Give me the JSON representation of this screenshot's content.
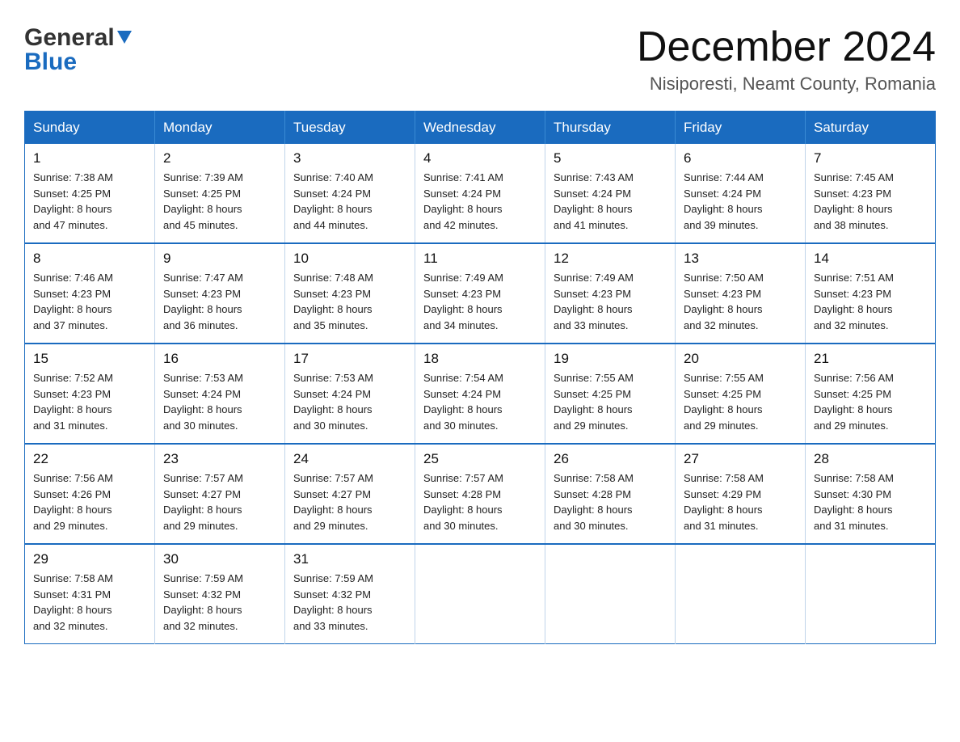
{
  "header": {
    "logo_general": "General",
    "logo_blue": "Blue",
    "title": "December 2024",
    "subtitle": "Nisiporesti, Neamt County, Romania"
  },
  "weekdays": [
    "Sunday",
    "Monday",
    "Tuesday",
    "Wednesday",
    "Thursday",
    "Friday",
    "Saturday"
  ],
  "weeks": [
    [
      {
        "day": 1,
        "sunrise": "7:38 AM",
        "sunset": "4:25 PM",
        "daylight": "8 hours and 47 minutes."
      },
      {
        "day": 2,
        "sunrise": "7:39 AM",
        "sunset": "4:25 PM",
        "daylight": "8 hours and 45 minutes."
      },
      {
        "day": 3,
        "sunrise": "7:40 AM",
        "sunset": "4:24 PM",
        "daylight": "8 hours and 44 minutes."
      },
      {
        "day": 4,
        "sunrise": "7:41 AM",
        "sunset": "4:24 PM",
        "daylight": "8 hours and 42 minutes."
      },
      {
        "day": 5,
        "sunrise": "7:43 AM",
        "sunset": "4:24 PM",
        "daylight": "8 hours and 41 minutes."
      },
      {
        "day": 6,
        "sunrise": "7:44 AM",
        "sunset": "4:24 PM",
        "daylight": "8 hours and 39 minutes."
      },
      {
        "day": 7,
        "sunrise": "7:45 AM",
        "sunset": "4:23 PM",
        "daylight": "8 hours and 38 minutes."
      }
    ],
    [
      {
        "day": 8,
        "sunrise": "7:46 AM",
        "sunset": "4:23 PM",
        "daylight": "8 hours and 37 minutes."
      },
      {
        "day": 9,
        "sunrise": "7:47 AM",
        "sunset": "4:23 PM",
        "daylight": "8 hours and 36 minutes."
      },
      {
        "day": 10,
        "sunrise": "7:48 AM",
        "sunset": "4:23 PM",
        "daylight": "8 hours and 35 minutes."
      },
      {
        "day": 11,
        "sunrise": "7:49 AM",
        "sunset": "4:23 PM",
        "daylight": "8 hours and 34 minutes."
      },
      {
        "day": 12,
        "sunrise": "7:49 AM",
        "sunset": "4:23 PM",
        "daylight": "8 hours and 33 minutes."
      },
      {
        "day": 13,
        "sunrise": "7:50 AM",
        "sunset": "4:23 PM",
        "daylight": "8 hours and 32 minutes."
      },
      {
        "day": 14,
        "sunrise": "7:51 AM",
        "sunset": "4:23 PM",
        "daylight": "8 hours and 32 minutes."
      }
    ],
    [
      {
        "day": 15,
        "sunrise": "7:52 AM",
        "sunset": "4:23 PM",
        "daylight": "8 hours and 31 minutes."
      },
      {
        "day": 16,
        "sunrise": "7:53 AM",
        "sunset": "4:24 PM",
        "daylight": "8 hours and 30 minutes."
      },
      {
        "day": 17,
        "sunrise": "7:53 AM",
        "sunset": "4:24 PM",
        "daylight": "8 hours and 30 minutes."
      },
      {
        "day": 18,
        "sunrise": "7:54 AM",
        "sunset": "4:24 PM",
        "daylight": "8 hours and 30 minutes."
      },
      {
        "day": 19,
        "sunrise": "7:55 AM",
        "sunset": "4:25 PM",
        "daylight": "8 hours and 29 minutes."
      },
      {
        "day": 20,
        "sunrise": "7:55 AM",
        "sunset": "4:25 PM",
        "daylight": "8 hours and 29 minutes."
      },
      {
        "day": 21,
        "sunrise": "7:56 AM",
        "sunset": "4:25 PM",
        "daylight": "8 hours and 29 minutes."
      }
    ],
    [
      {
        "day": 22,
        "sunrise": "7:56 AM",
        "sunset": "4:26 PM",
        "daylight": "8 hours and 29 minutes."
      },
      {
        "day": 23,
        "sunrise": "7:57 AM",
        "sunset": "4:27 PM",
        "daylight": "8 hours and 29 minutes."
      },
      {
        "day": 24,
        "sunrise": "7:57 AM",
        "sunset": "4:27 PM",
        "daylight": "8 hours and 29 minutes."
      },
      {
        "day": 25,
        "sunrise": "7:57 AM",
        "sunset": "4:28 PM",
        "daylight": "8 hours and 30 minutes."
      },
      {
        "day": 26,
        "sunrise": "7:58 AM",
        "sunset": "4:28 PM",
        "daylight": "8 hours and 30 minutes."
      },
      {
        "day": 27,
        "sunrise": "7:58 AM",
        "sunset": "4:29 PM",
        "daylight": "8 hours and 31 minutes."
      },
      {
        "day": 28,
        "sunrise": "7:58 AM",
        "sunset": "4:30 PM",
        "daylight": "8 hours and 31 minutes."
      }
    ],
    [
      {
        "day": 29,
        "sunrise": "7:58 AM",
        "sunset": "4:31 PM",
        "daylight": "8 hours and 32 minutes."
      },
      {
        "day": 30,
        "sunrise": "7:59 AM",
        "sunset": "4:32 PM",
        "daylight": "8 hours and 32 minutes."
      },
      {
        "day": 31,
        "sunrise": "7:59 AM",
        "sunset": "4:32 PM",
        "daylight": "8 hours and 33 minutes."
      },
      null,
      null,
      null,
      null
    ]
  ],
  "labels": {
    "sunrise": "Sunrise:",
    "sunset": "Sunset:",
    "daylight": "Daylight:"
  }
}
